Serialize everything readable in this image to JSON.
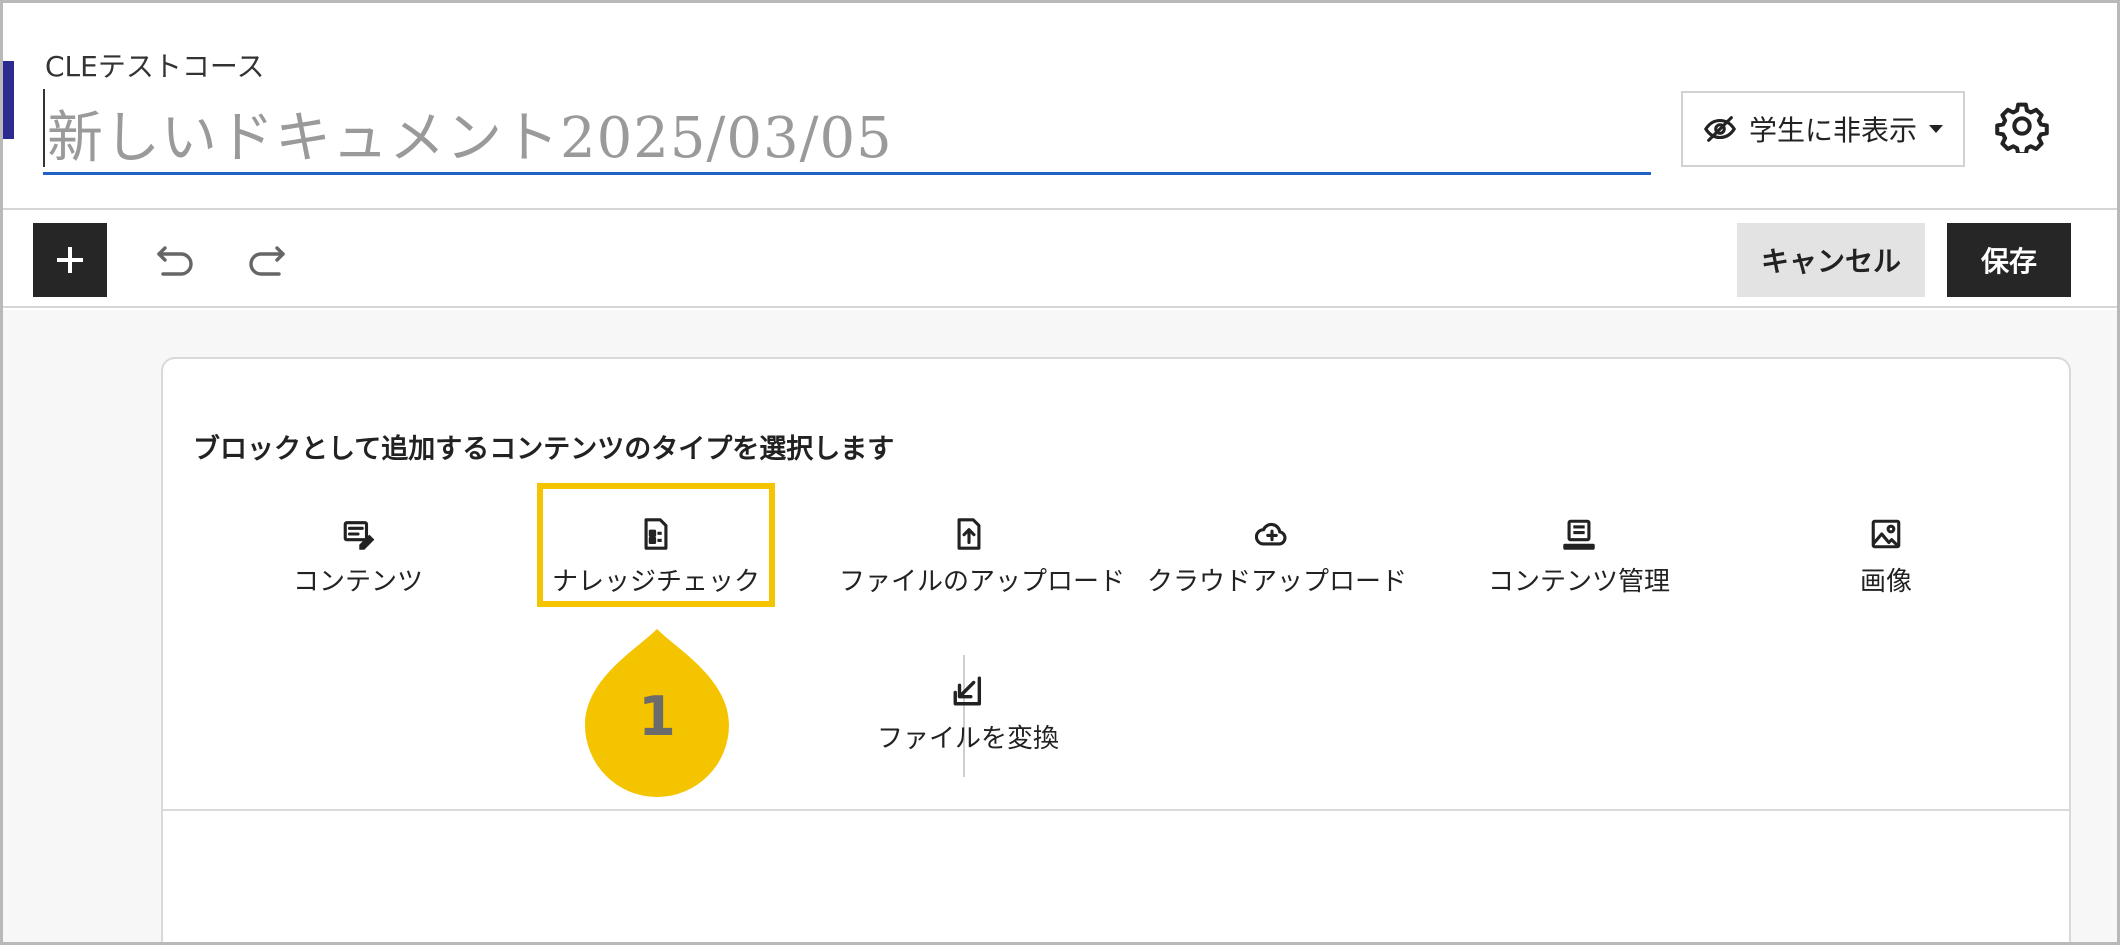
{
  "header": {
    "course_name": "CLEテストコース",
    "document_title": "新しいドキュメント2025/03/05",
    "visibility_label": "学生に非表示",
    "icons": {
      "visibility": "eye-slash-icon",
      "settings": "gear-icon"
    }
  },
  "toolbar": {
    "add_label": "+",
    "cancel_label": "キャンセル",
    "save_label": "保存",
    "icons": {
      "undo": "undo-icon",
      "redo": "redo-icon"
    }
  },
  "panel": {
    "prompt": "ブロックとして追加するコンテンツのタイプを選択します",
    "tiles": [
      {
        "label": "コンテンツ",
        "icon": "content-icon"
      },
      {
        "label": "ナレッジチェック",
        "icon": "knowledge-check-icon"
      },
      {
        "label": "ファイルのアップロード",
        "icon": "file-upload-icon"
      },
      {
        "label": "クラウドアップロード",
        "icon": "cloud-upload-icon"
      },
      {
        "label": "コンテンツ管理",
        "icon": "content-management-icon"
      },
      {
        "label": "画像",
        "icon": "image-icon"
      },
      {
        "label": "ファイルを変換",
        "icon": "convert-file-icon"
      }
    ]
  },
  "callout": {
    "number": "1"
  },
  "colors": {
    "accent": "#2d2b8f",
    "title_underline": "#1f63c6",
    "highlight": "#f5c400",
    "dark_button": "#262626"
  }
}
